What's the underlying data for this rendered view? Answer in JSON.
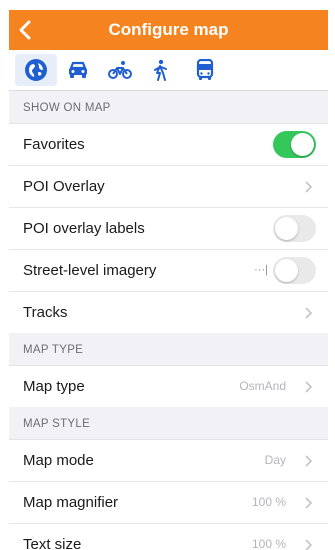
{
  "header": {
    "title": "Configure map"
  },
  "modes": [
    {
      "icon": "globe-icon",
      "selected": true
    },
    {
      "icon": "car-icon",
      "selected": false
    },
    {
      "icon": "bicycle-icon",
      "selected": false
    },
    {
      "icon": "pedestrian-icon",
      "selected": false
    },
    {
      "icon": "bus-icon",
      "selected": false
    }
  ],
  "sections": {
    "show_on_map": {
      "header": "SHOW ON MAP",
      "favorites": {
        "label": "Favorites",
        "enabled": true
      },
      "poi_overlay": {
        "label": "POI Overlay"
      },
      "poi_overlay_labels": {
        "label": "POI overlay labels",
        "enabled": false
      },
      "street_level": {
        "label": "Street-level imagery",
        "more": "···|",
        "enabled": false
      },
      "tracks": {
        "label": "Tracks"
      }
    },
    "map_type": {
      "header": "MAP TYPE",
      "map_type_row": {
        "label": "Map type",
        "value": "OsmAnd"
      }
    },
    "map_style": {
      "header": "MAP STYLE",
      "map_mode": {
        "label": "Map mode",
        "value": "Day"
      },
      "map_magnifier": {
        "label": "Map magnifier",
        "value": "100 %"
      },
      "text_size": {
        "label": "Text size",
        "value": "100 %"
      }
    }
  },
  "colors": {
    "accent": "#f5831f",
    "toggle_on": "#34c759",
    "mode_icon": "#1f5fd1"
  }
}
